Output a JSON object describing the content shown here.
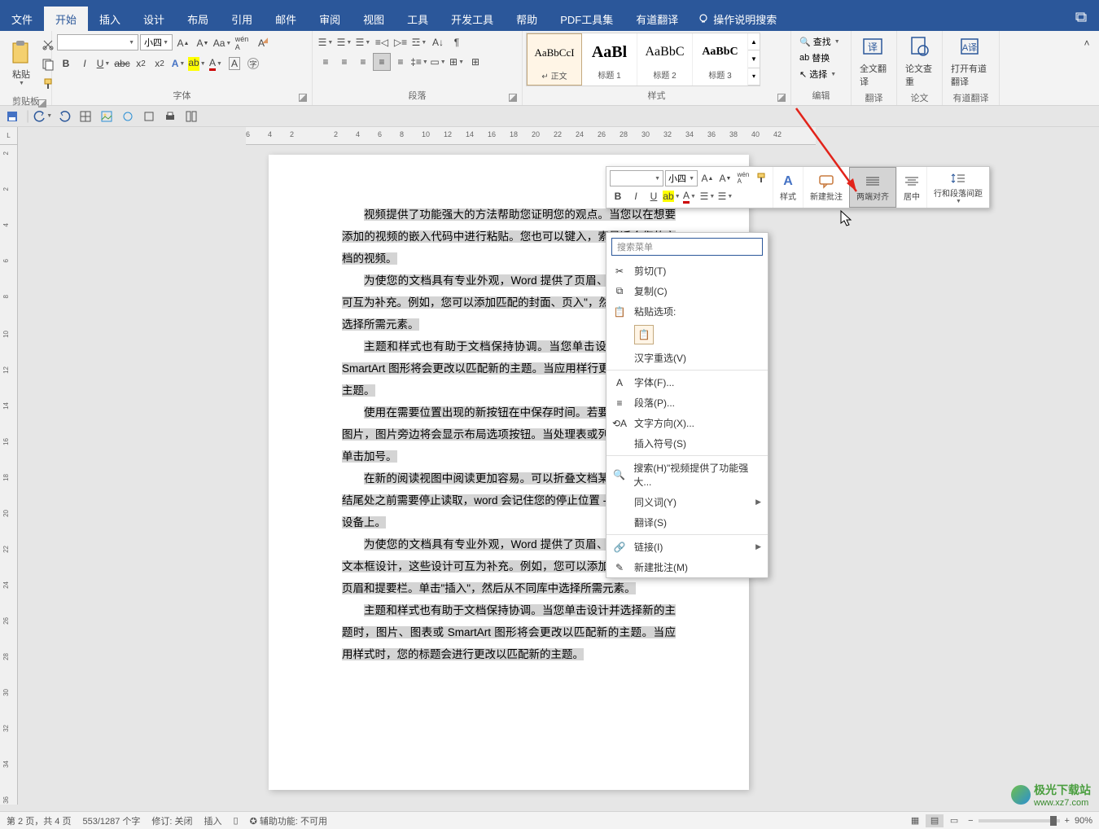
{
  "menubar": {
    "tabs": [
      "文件",
      "开始",
      "插入",
      "设计",
      "布局",
      "引用",
      "邮件",
      "审阅",
      "视图",
      "工具",
      "开发工具",
      "帮助",
      "PDF工具集",
      "有道翻译"
    ],
    "active_index": 1,
    "tellme": "操作说明搜索"
  },
  "ribbon": {
    "clipboard": {
      "paste": "粘贴",
      "label": "剪贴板"
    },
    "font": {
      "name": "",
      "size": "小四",
      "label": "字体"
    },
    "paragraph": {
      "label": "段落"
    },
    "styles": {
      "items": [
        {
          "preview": "AaBbCcI",
          "name": "↵ 正文"
        },
        {
          "preview": "AaBl",
          "name": "标题 1"
        },
        {
          "preview": "AaBbC",
          "name": "标题 2"
        },
        {
          "preview": "AaBbC",
          "name": "标题 3"
        }
      ],
      "label": "样式"
    },
    "editing": {
      "find": "查找",
      "replace": "替换",
      "select": "选择",
      "label": "编辑"
    },
    "translate_full": {
      "label": "全文翻译",
      "group": "翻译"
    },
    "thesis": {
      "label": "论文查重",
      "group": "论文"
    },
    "youdao": {
      "label": "打开有道翻译",
      "group": "有道翻译"
    }
  },
  "minitoolbar": {
    "font_name": "",
    "font_size": "小四",
    "side": [
      {
        "label": "样式",
        "key": "styles"
      },
      {
        "label": "新建批注",
        "key": "new-comment"
      },
      {
        "label": "两端对齐",
        "key": "justify"
      },
      {
        "label": "居中",
        "key": "center"
      },
      {
        "label": "行和段落间距",
        "key": "line-spacing"
      }
    ]
  },
  "contextmenu": {
    "search_placeholder": "搜索菜单",
    "items": [
      {
        "ico": "✂",
        "label": "剪切(T)",
        "key": "cut"
      },
      {
        "ico": "⧉",
        "label": "复制(C)",
        "key": "copy"
      },
      {
        "ico": "📋",
        "label": "粘贴选项:",
        "key": "paste-options",
        "noclick": true
      },
      {
        "type": "paste-opt"
      },
      {
        "label": "汉字重选(V)",
        "key": "reconvert"
      },
      {
        "type": "sep"
      },
      {
        "ico": "A",
        "label": "字体(F)...",
        "key": "font"
      },
      {
        "ico": "¶",
        "label": "段落(P)...",
        "key": "paragraph"
      },
      {
        "ico": "⟲",
        "label": "文字方向(X)...",
        "key": "text-direction"
      },
      {
        "label": "插入符号(S)",
        "key": "insert-symbol"
      },
      {
        "type": "sep"
      },
      {
        "ico": "🔍",
        "label": "搜索(H)\"视频提供了功能强大...",
        "key": "search"
      },
      {
        "label": "同义词(Y)",
        "key": "synonyms",
        "arrow": true
      },
      {
        "label": "翻译(S)",
        "key": "translate"
      },
      {
        "type": "sep"
      },
      {
        "ico": "🔗",
        "label": "链接(I)",
        "key": "link",
        "arrow": true
      },
      {
        "ico": "✎",
        "label": "新建批注(M)",
        "key": "new-comment"
      }
    ]
  },
  "document": {
    "paragraphs": [
      "视频提供了功能强大的方法帮助您证明您的观点。当您以在想要添加的视频的嵌入代码中进行粘贴。您也可以键入，索最适合您的文档的视频。",
      "为使您的文档具有专业外观，Word 提供了页眉、页脚这些设计可互为补充。例如，您可以添加匹配的封面、页入\"，然后从不同库中选择所需元素。",
      "主题和样式也有助于文档保持协调。当您单击设计并选图表或 SmartArt 图形将会更改以匹配新的主题。当应用样行更改以匹配新的主题。",
      "使用在需要位置出现的新按钮在中保存时间。若要更改请单击该图片，图片旁边将会显示布局选项按钮。当处理表或列的位置，然后单击加号。",
      "在新的阅读视图中阅读更加容易。可以折叠文档某些如果在达到结尾处之前需要停止读取，word 会记住您的停止位置 - 即使在另一个设备上。",
      "为使您的文档具有专业外观，Word 提供了页眉、页脚、封面和文本框设计，这些设计可互为补充。例如，您可以添加匹配的封面、页眉和提要栏。单击\"插入\"，然后从不同库中选择所需元素。",
      "主题和样式也有助于文档保持协调。当您单击设计并选择新的主题时，图片、图表或 SmartArt 图形将会更改以匹配新的主题。当应用样式时，您的标题会进行更改以匹配新的主题。"
    ]
  },
  "hruler_ticks": [
    "6",
    "4",
    "2",
    "",
    "2",
    "4",
    "6",
    "8",
    "10",
    "12",
    "14",
    "16",
    "18",
    "20",
    "22",
    "24",
    "26",
    "28",
    "30",
    "32",
    "34",
    "36",
    "38",
    "40",
    "42"
  ],
  "vruler_ticks": [
    "2",
    "2",
    "4",
    "6",
    "8",
    "10",
    "12",
    "14",
    "16",
    "18",
    "20",
    "22",
    "24",
    "26",
    "28",
    "30",
    "32",
    "34",
    "36"
  ],
  "statusbar": {
    "page": "第 2 页，共 4 页",
    "words": "553/1287 个字",
    "track": "修订: 关闭",
    "insert": "插入",
    "a11y": "辅助功能: 不可用",
    "zoom": "90%"
  },
  "watermark": {
    "brand": "极光下载站",
    "url": "www.xz7.com"
  }
}
